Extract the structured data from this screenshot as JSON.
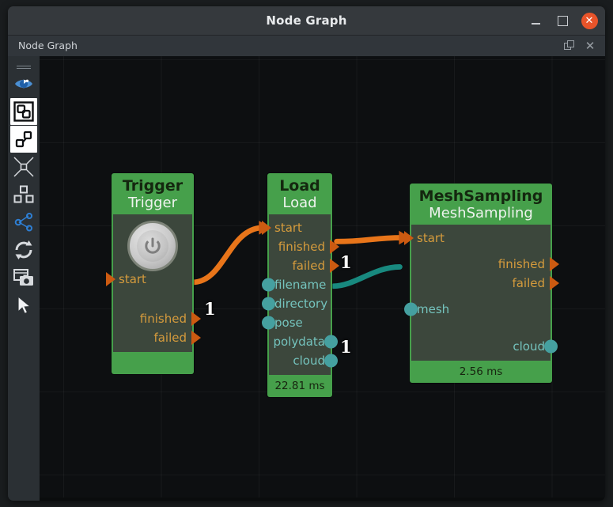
{
  "window": {
    "title": "Node Graph",
    "buttons": {
      "minimize": "minimize",
      "maximize": "maximize",
      "close": "✕"
    }
  },
  "dock": {
    "title": "Node Graph",
    "float_label": "float",
    "close_label": "✕"
  },
  "toolbar": {
    "items": [
      {
        "name": "eye-icon",
        "label": "Toggle Visibility",
        "active": false
      },
      {
        "name": "node-frame-icon",
        "label": "Frame Nodes",
        "active": true
      },
      {
        "name": "node-select-icon",
        "label": "Select Nodes",
        "active": true
      },
      {
        "name": "collapse-arrows-icon",
        "label": "Collapse",
        "active": false
      },
      {
        "name": "layout-grid-icon",
        "label": "Arrange Layout",
        "active": false
      },
      {
        "name": "graph-share-icon",
        "label": "Graph Links",
        "active": false
      },
      {
        "name": "refresh-icon",
        "label": "Refresh Graph",
        "active": false
      },
      {
        "name": "screenshot-icon",
        "label": "Capture Screenshot",
        "active": false
      },
      {
        "name": "cursor-icon",
        "label": "Select Tool",
        "active": false
      }
    ]
  },
  "graph": {
    "colors": {
      "node_header": "#46a04b",
      "node_body": "#3c473c",
      "exec_port": "#cc5a11",
      "exec_text": "#d59b3c",
      "data_port": "#45a0a0",
      "data_text": "#74c3bd",
      "wire_exec": "#e8751a",
      "wire_data": "#18897f",
      "canvas_bg": "#0d0f11"
    },
    "nodes": [
      {
        "id": "trigger",
        "type": "Trigger",
        "name": "Trigger",
        "time": "",
        "has_power_icon": true,
        "inputs": [
          {
            "label": "start",
            "kind": "exec"
          }
        ],
        "outputs": [
          {
            "label": "finished",
            "kind": "exec"
          },
          {
            "label": "failed",
            "kind": "exec"
          }
        ]
      },
      {
        "id": "load",
        "type": "Load",
        "name": "Load",
        "time": "22.81 ms",
        "has_power_icon": false,
        "inputs": [
          {
            "label": "start",
            "kind": "exec"
          },
          {
            "label": "filename",
            "kind": "data"
          },
          {
            "label": "directory",
            "kind": "data"
          },
          {
            "label": "pose",
            "kind": "data"
          }
        ],
        "outputs": [
          {
            "label": "finished",
            "kind": "exec"
          },
          {
            "label": "failed",
            "kind": "exec"
          },
          {
            "label": "polydata",
            "kind": "data"
          },
          {
            "label": "cloud",
            "kind": "data"
          }
        ]
      },
      {
        "id": "meshsampling",
        "type": "MeshSampling",
        "name": "MeshSampling",
        "time": "2.56 ms",
        "has_power_icon": false,
        "inputs": [
          {
            "label": "start",
            "kind": "exec"
          },
          {
            "label": "mesh",
            "kind": "data"
          }
        ],
        "outputs": [
          {
            "label": "finished",
            "kind": "exec"
          },
          {
            "label": "failed",
            "kind": "exec"
          },
          {
            "label": "cloud",
            "kind": "data"
          }
        ]
      }
    ],
    "connections": [
      {
        "from": "trigger.finished",
        "to": "load.start",
        "kind": "exec",
        "label": "1"
      },
      {
        "from": "load.finished",
        "to": "meshsampling.start",
        "kind": "exec",
        "label": "1"
      },
      {
        "from": "load.polydata",
        "to": "meshsampling.mesh",
        "kind": "data",
        "label": "1"
      }
    ]
  }
}
